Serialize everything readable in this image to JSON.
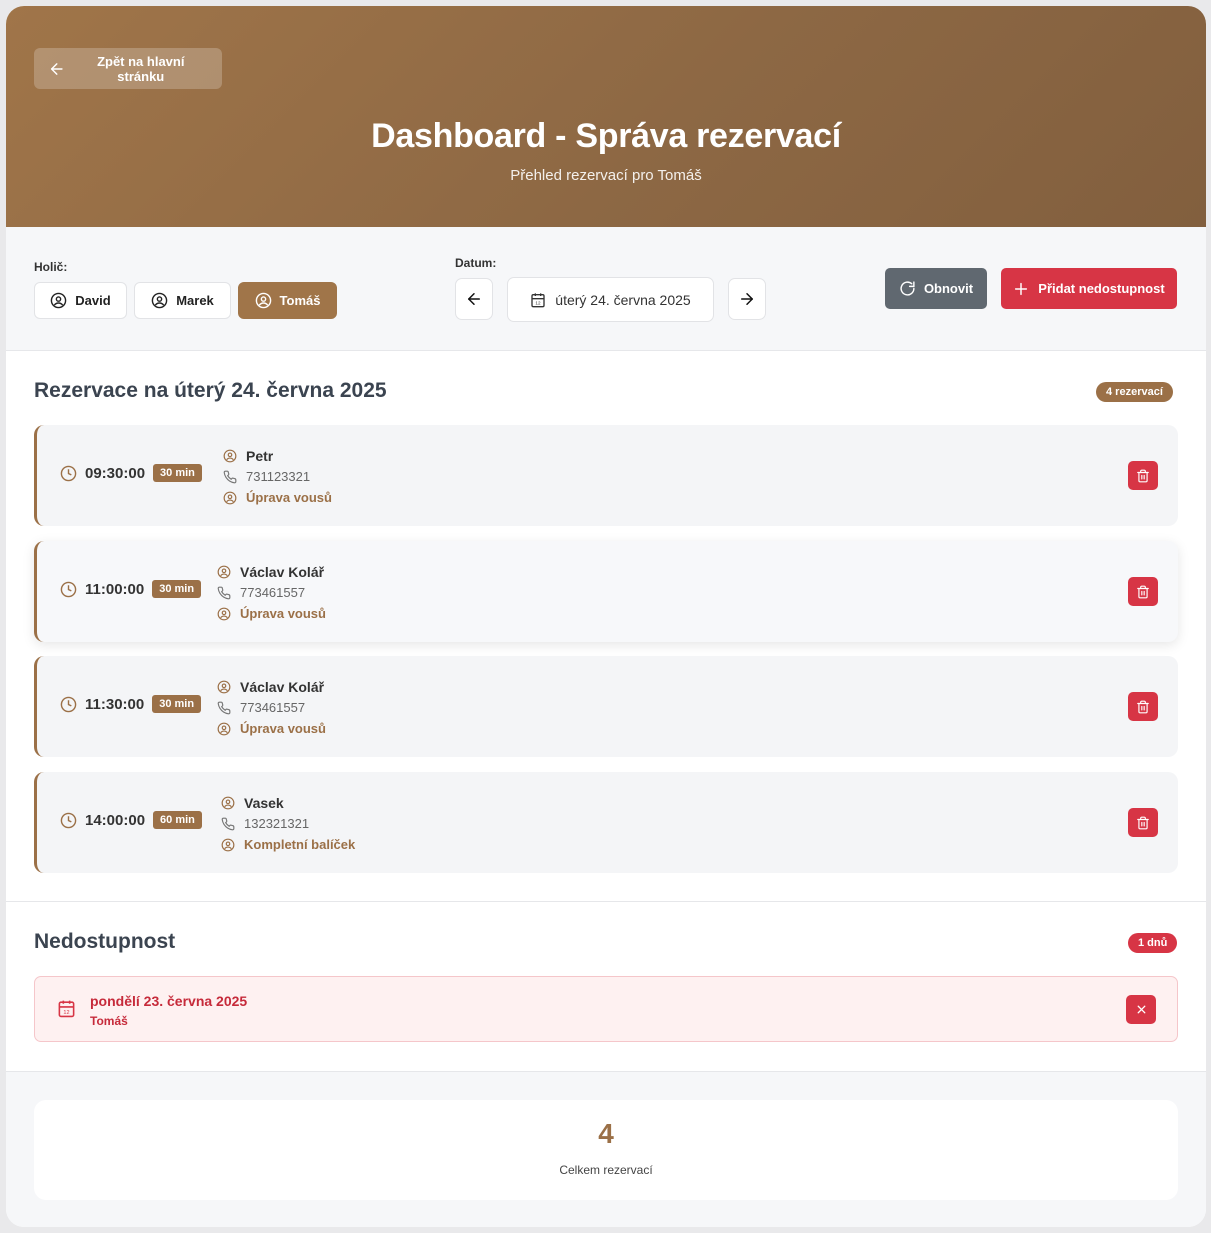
{
  "header": {
    "back_label": "Zpět na hlavní stránku",
    "title": "Dashboard - Správa rezervací",
    "subtitle": "Přehled rezervací pro Tomáš"
  },
  "toolbar": {
    "barber_label": "Holič:",
    "barbers": [
      {
        "name": "David",
        "active": false
      },
      {
        "name": "Marek",
        "active": false
      },
      {
        "name": "Tomáš",
        "active": true
      }
    ],
    "date_label": "Datum:",
    "date_value": "úterý 24. června 2025",
    "refresh_label": "Obnovit",
    "add_unavailability_label": "Přidat nedostupnost"
  },
  "reservations": {
    "title": "Rezervace na úterý 24. června 2025",
    "count_badge": "4 rezervací",
    "items": [
      {
        "time": "09:30:00",
        "duration": "30 min",
        "name": "Petr",
        "phone": "731123321",
        "service": "Úprava vousů"
      },
      {
        "time": "11:00:00",
        "duration": "30 min",
        "name": "Václav Kolář",
        "phone": "773461557",
        "service": "Úprava vousů"
      },
      {
        "time": "11:30:00",
        "duration": "30 min",
        "name": "Václav Kolář",
        "phone": "773461557",
        "service": "Úprava vousů"
      },
      {
        "time": "14:00:00",
        "duration": "60 min",
        "name": "Vasek",
        "phone": "132321321",
        "service": "Kompletní balíček"
      }
    ]
  },
  "unavailability": {
    "title": "Nedostupnost",
    "count_badge": "1 dnů",
    "items": [
      {
        "date": "pondělí 23. června 2025",
        "barber": "Tomáš"
      }
    ]
  },
  "summary": {
    "total_value": "4",
    "total_label": "Celkem rezervací"
  },
  "colors": {
    "brand": "#a07549",
    "danger": "#d73545",
    "neutral_button": "#606870"
  }
}
